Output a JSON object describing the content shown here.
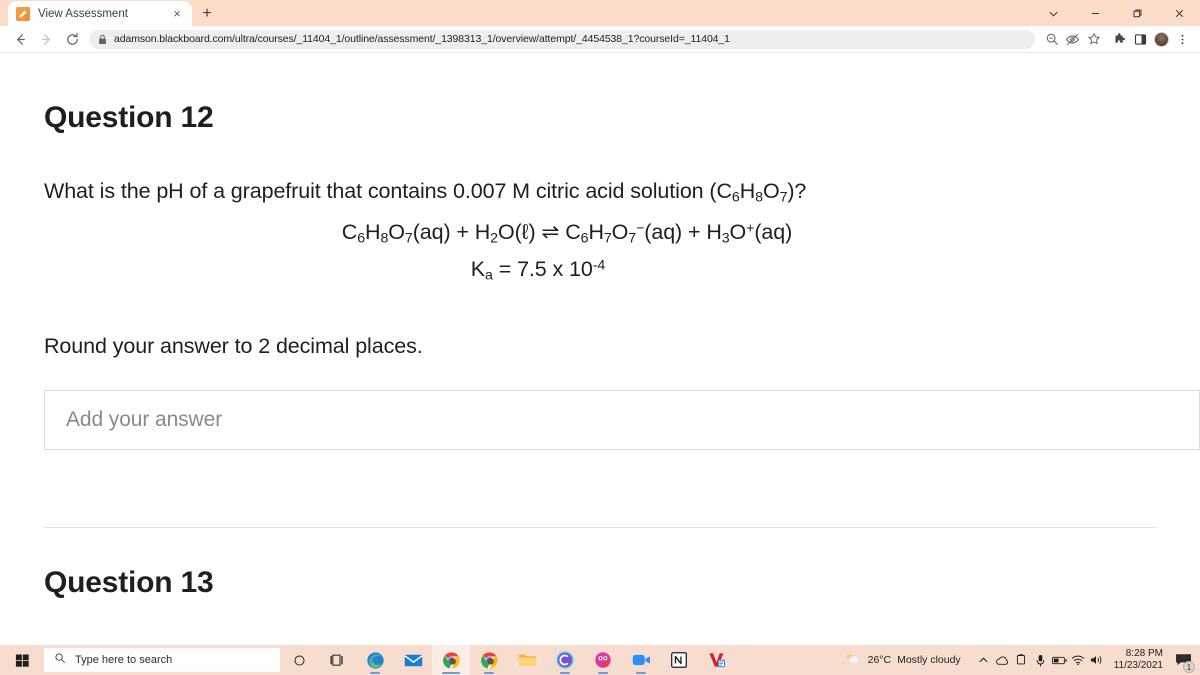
{
  "browser": {
    "tab": {
      "title": "View Assessment",
      "favicon": "pencil-icon",
      "close": "×"
    },
    "new_tab_label": "+",
    "window_controls": [
      "chevron-down-icon",
      "minimize-icon",
      "restore-icon",
      "close-icon"
    ],
    "nav": {
      "back": "back-icon",
      "forward": "forward-icon",
      "reload": "reload-icon"
    },
    "omnibox": {
      "lock": "lock-icon",
      "url": "adamson.blackboard.com/ultra/courses/_11404_1/outline/assessment/_1398313_1/overview/attempt/_4454538_1?courseId=_11404_1"
    },
    "toolbar_icons": [
      "zoom-out-icon",
      "eye-slash-icon",
      "star-icon",
      "extensions-icon",
      "sidebar-icon",
      "profile-avatar",
      "menu-kebab-icon"
    ],
    "colors": {
      "titlebar": "#fadcc8",
      "omnibox": "#eeeeee",
      "taskbar": "#f7ddd0"
    }
  },
  "assessment": {
    "question_title": "Question 12",
    "prompt_parts": {
      "lead": "What is the pH of a grapefruit that contains 0.007 M citric acid solution (C",
      "sub1": "6",
      "mid1": "H",
      "sub2": "8",
      "mid2": "O",
      "sub3": "7",
      "tail": ")?"
    },
    "equation": "C6H8O7(aq) + H2O(ℓ) ⇌ C6H7O7⁻(aq) + H3O⁺(aq)",
    "ka_line": "Ka = 7.5 x 10-4",
    "ka": {
      "label": "K",
      "sub": "a",
      "equals": "=",
      "value": "7.5 x 10",
      "exponent": "-4"
    },
    "instruction": "Round your answer to 2 decimal places.",
    "answer_input": {
      "placeholder": "Add your answer",
      "value": ""
    },
    "next_question_title": "Question 13"
  },
  "taskbar": {
    "start": "windows-start-icon",
    "search_placeholder": "Type here to search",
    "search_icon": "search-icon",
    "buttons": [
      {
        "name": "task-view-cortana",
        "icon": "circle-icon"
      },
      {
        "name": "task-view",
        "icon": "task-view-icon"
      },
      {
        "name": "microsoft-edge",
        "icon": "edge-icon"
      },
      {
        "name": "mail",
        "icon": "mail-icon"
      },
      {
        "name": "google-chrome-1",
        "icon": "chrome-icon"
      },
      {
        "name": "google-chrome-2",
        "icon": "chrome-icon"
      },
      {
        "name": "file-explorer",
        "icon": "folder-icon"
      },
      {
        "name": "app-c",
        "icon": "c-circle-icon"
      },
      {
        "name": "app-pink",
        "icon": "pink-circle-icon"
      },
      {
        "name": "zoom",
        "icon": "video-camera-icon"
      },
      {
        "name": "notion",
        "icon": "notion-icon"
      },
      {
        "name": "app-v",
        "icon": "v-icon"
      }
    ],
    "weather": {
      "icon": "cloud-sun-icon",
      "temperature": "26°C",
      "description": "Mostly cloudy"
    },
    "tray_icons": [
      "chevron-up-icon",
      "onedrive-icon",
      "display-icon",
      "microphone-icon",
      "battery-icon",
      "wifi-icon",
      "volume-icon"
    ],
    "clock": {
      "time": "8:28 PM",
      "date": "11/23/2021"
    },
    "notifications": {
      "icon": "chat-icon",
      "count": "1"
    }
  }
}
